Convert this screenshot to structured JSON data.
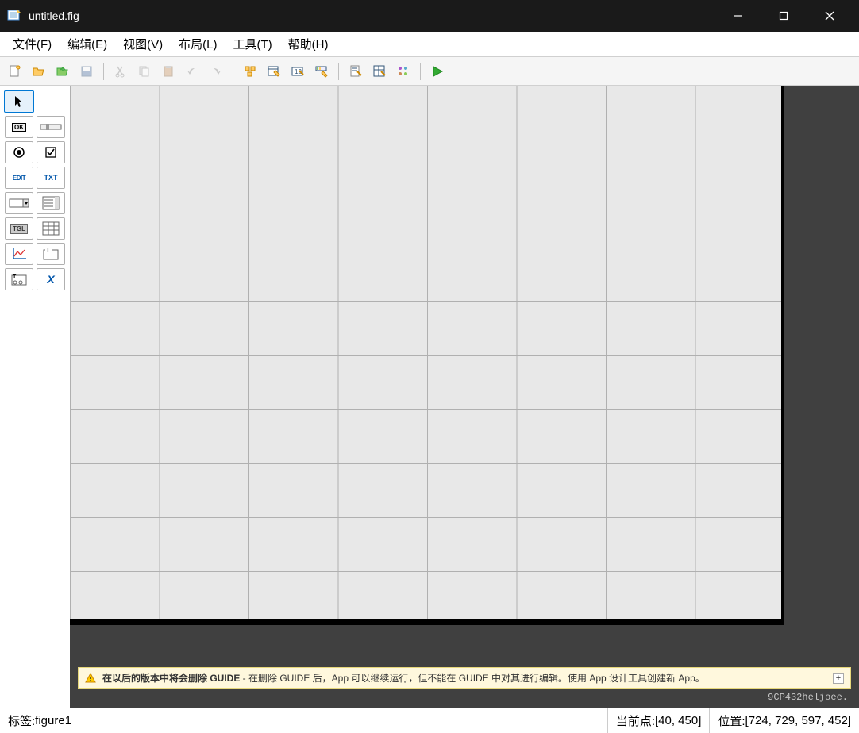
{
  "titlebar": {
    "title": "untitled.fig"
  },
  "menu": {
    "items": [
      "文件(F)",
      "编辑(E)",
      "视图(V)",
      "布局(L)",
      "工具(T)",
      "帮助(H)"
    ]
  },
  "toolbar": {
    "new": "new",
    "open": "open",
    "save": "save",
    "savefig": "savefig",
    "cut": "cut",
    "copy": "copy",
    "paste": "paste",
    "undo": "undo",
    "redo": "redo",
    "align": "align",
    "editor": "editor",
    "menu_editor": "menu_editor",
    "tab_editor": "tab_editor",
    "mfile": "mfile",
    "prop_insp": "prop_insp",
    "obj_browser": "obj_browser",
    "run": "run"
  },
  "palette": {
    "select": "select",
    "pushbutton": "OK",
    "slider": "slider",
    "radio": "radio",
    "checkbox": "checkbox",
    "edit": "EDIT",
    "text": "TXT",
    "popup": "popup",
    "listbox": "listbox",
    "toggle": "TGL",
    "table": "table",
    "axes": "axes",
    "panel": "T",
    "buttongroup": "T:o",
    "activex": "X"
  },
  "warning": {
    "bold": "在以后的版本中将会删除 GUIDE",
    "rest": " - 在删除 GUIDE 后，App 可以继续运行，但不能在 GUIDE 中对其进行编辑。使用 App 设计工具创建新 App。",
    "expand": "+"
  },
  "status": {
    "tag_label": "标签: ",
    "tag_value": "figure1",
    "curpoint_label": "当前点:  ",
    "curpoint_value": "[40, 450]",
    "position_label": "位置: ",
    "position_value": "[724, 729, 597, 452]"
  },
  "watermark": "9CP432heljoee."
}
